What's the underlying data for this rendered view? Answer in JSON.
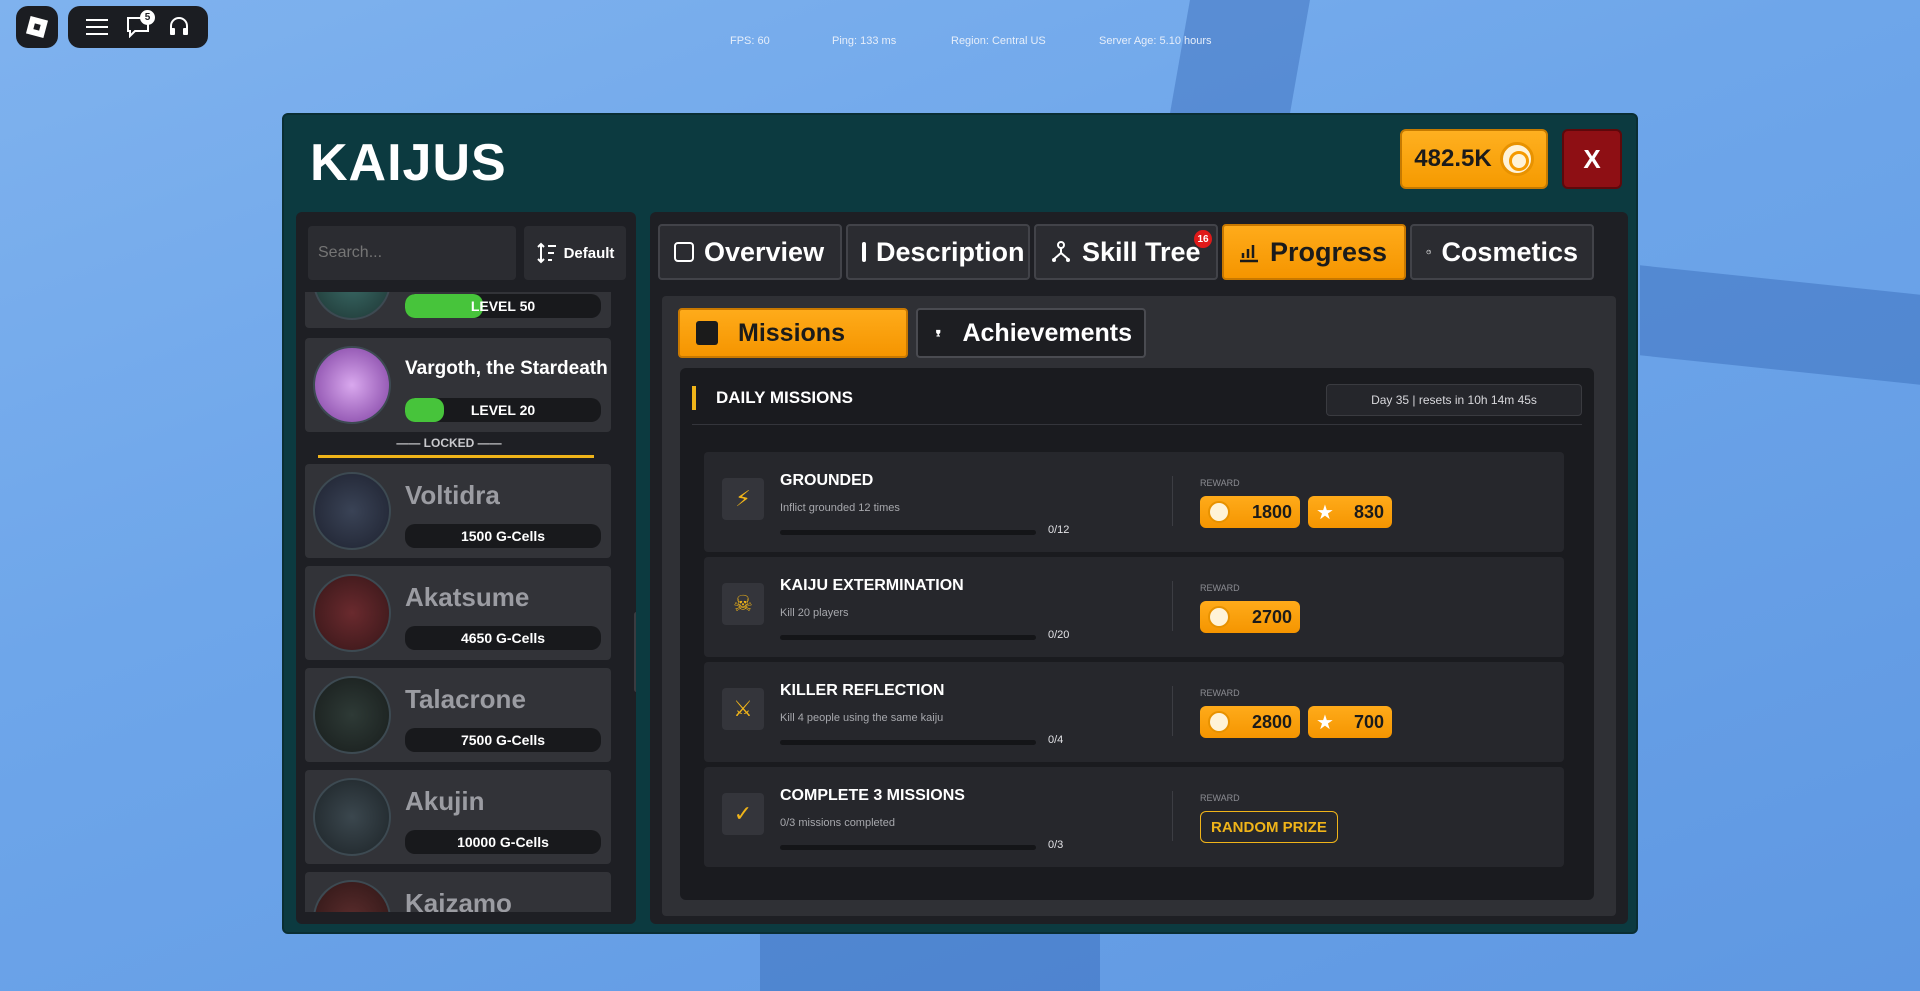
{
  "stats": {
    "fps": "FPS: 60",
    "ping": "Ping: 133 ms",
    "region": "Region: Central US",
    "server_age": "Server Age: 5.10 hours"
  },
  "topbar": {
    "chat_badge": "5"
  },
  "window": {
    "title": "KAIJUS",
    "currency": "482.5K",
    "close_label": "X"
  },
  "left": {
    "search_placeholder": "Search...",
    "sort_label": "Default",
    "locked_label": "—— LOCKED ——",
    "kaijus": [
      {
        "name": "",
        "pill": "LEVEL 50",
        "progress": 0.5,
        "owned": true
      },
      {
        "name": "Vargoth, the Stardeath",
        "pill": "LEVEL 20",
        "progress": 0.2,
        "owned": true
      },
      {
        "name": "Voltidra",
        "pill": "1500 G-Cells",
        "owned": false
      },
      {
        "name": "Akatsume",
        "pill": "4650 G-Cells",
        "owned": false
      },
      {
        "name": "Talacrone",
        "pill": "7500 G-Cells",
        "owned": false
      },
      {
        "name": "Akujin",
        "pill": "10000 G-Cells",
        "owned": false
      },
      {
        "name": "Kaizamo",
        "pill": "",
        "owned": false
      }
    ]
  },
  "tabs": [
    {
      "label": "Overview"
    },
    {
      "label": "Description"
    },
    {
      "label": "Skill Tree",
      "badge": "16"
    },
    {
      "label": "Progress",
      "active": true
    },
    {
      "label": "Cosmetics"
    }
  ],
  "subtabs": {
    "missions": "Missions",
    "achievements": "Achievements"
  },
  "missions": {
    "header": "DAILY MISSIONS",
    "reset_text": "Day 35 | resets in 10h 14m 45s",
    "reward_label": "REWARD",
    "items": [
      {
        "title": "GROUNDED",
        "desc": "Inflict grounded 12 times",
        "count": "0/12",
        "coins": "1800",
        "stars": "830",
        "icon": "lightning-icon"
      },
      {
        "title": "KAIJU EXTERMINATION",
        "desc": "Kill 20 players",
        "count": "0/20",
        "coins": "2700",
        "icon": "skull-icon"
      },
      {
        "title": "KILLER REFLECTION",
        "desc": "Kill 4 people using the same kaiju",
        "count": "0/4",
        "coins": "2800",
        "stars": "700",
        "icon": "crossed-swords-icon"
      },
      {
        "title": "COMPLETE 3 MISSIONS",
        "desc": "0/3 missions completed",
        "count": "0/3",
        "prize": "RANDOM PRIZE",
        "icon": "check-badge-icon"
      }
    ]
  },
  "colors": {
    "accent": "#f59a00",
    "window_bg": "#0c3a40",
    "close": "#8e0f14",
    "level_fill": "#47c43b",
    "locked_line": "#f0b419"
  }
}
